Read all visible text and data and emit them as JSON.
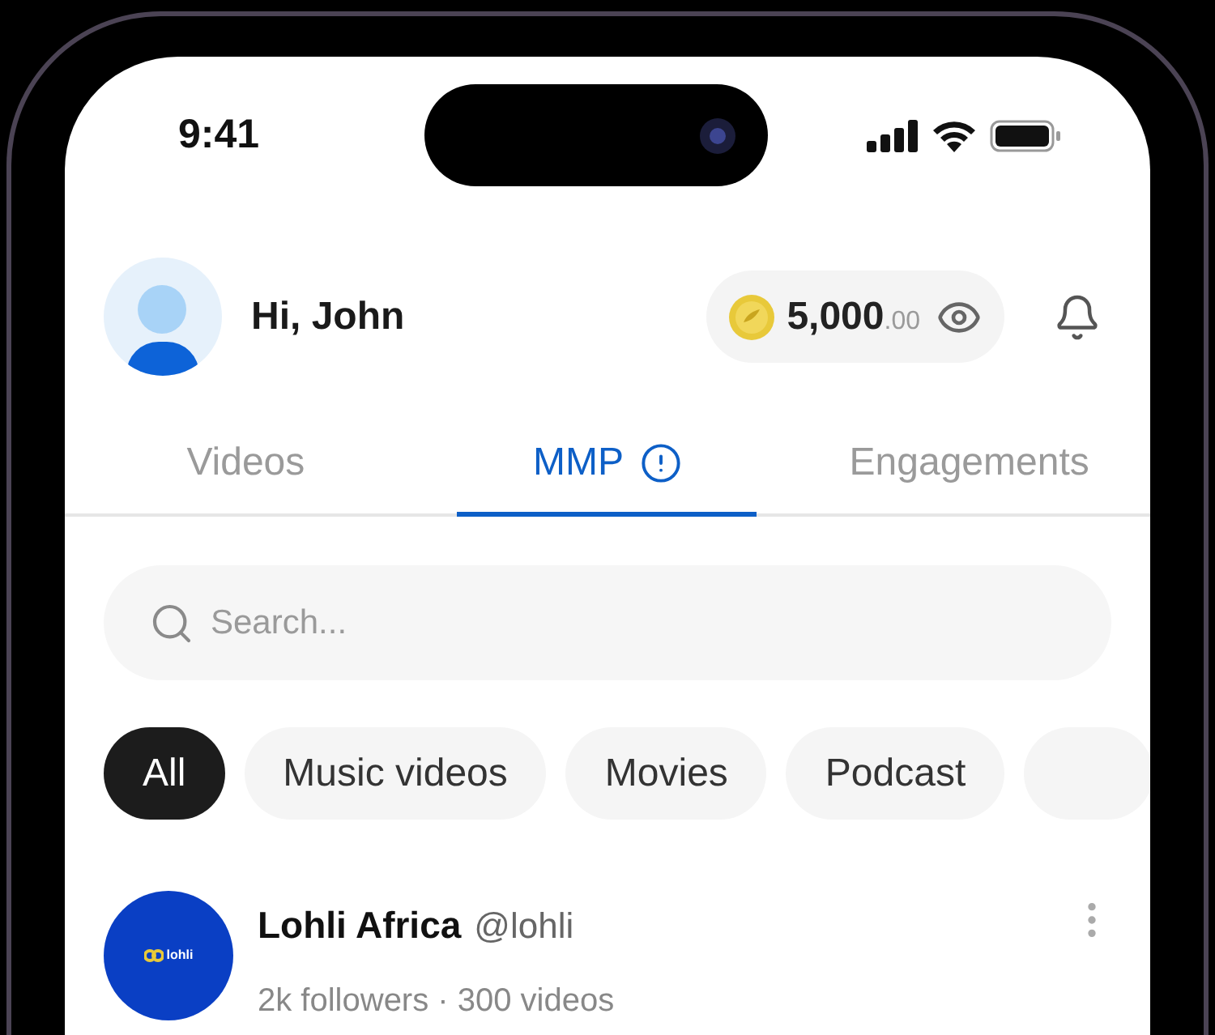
{
  "status_bar": {
    "time": "9:41"
  },
  "header": {
    "greeting": "Hi, John",
    "balance": {
      "whole": "5,000",
      "cents": ".00"
    }
  },
  "tabs": [
    {
      "label": "Videos",
      "selected": false,
      "info": false
    },
    {
      "label": "MMP",
      "selected": true,
      "info": true
    },
    {
      "label": "Engagements",
      "selected": false,
      "info": false
    }
  ],
  "search": {
    "placeholder": "Search..."
  },
  "chips": [
    {
      "label": "All",
      "selected": true
    },
    {
      "label": "Music videos",
      "selected": false
    },
    {
      "label": "Movies",
      "selected": false
    },
    {
      "label": "Podcast",
      "selected": false
    }
  ],
  "channels": [
    {
      "name": "Lohli Africa",
      "handle": "@lohli",
      "stats": "2k followers · 300 videos",
      "logo_text": "lohli"
    }
  ]
}
